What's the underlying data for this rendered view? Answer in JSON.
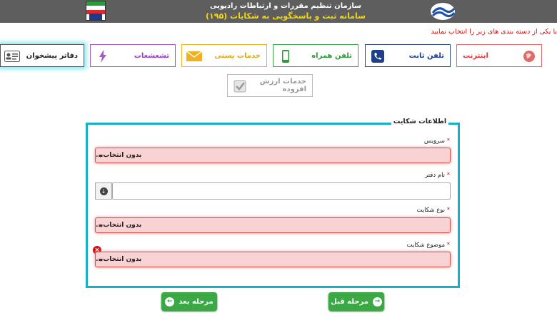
{
  "header": {
    "line1": "سازمان تنظیم مقررات و ارتباطات رادیویی",
    "line2": "سامانه ثبت و پاسخگویی به شکایات (۱۹۵)"
  },
  "instruction": "با یکی از دسته بندی های زیر را انتخاب نمایید",
  "categories": {
    "internet": "اینترنت",
    "phone": "تلفن ثابت",
    "mobile": "تلفن همراه",
    "post": "خدمات پستی",
    "radiation": "تشعشعات",
    "offices": "دفاتر پیشخوان",
    "vas": "خدمات ارزش افزوده"
  },
  "form": {
    "legend": "اطلاعات شکایت",
    "service_label": "سرویس",
    "office_label": "نام دفتر",
    "type_label": "نوع شکایت",
    "subject_label": "موضوع شکایت",
    "required_mark": "*",
    "select_placeholder": "بدون انتخاب...",
    "office_value": ""
  },
  "buttons": {
    "prev": "مرحله قبل",
    "next": "مرحله بعد"
  },
  "colors": {
    "accent": "#17b0c9",
    "error": "#d10f0f",
    "button": "#3aa845"
  }
}
